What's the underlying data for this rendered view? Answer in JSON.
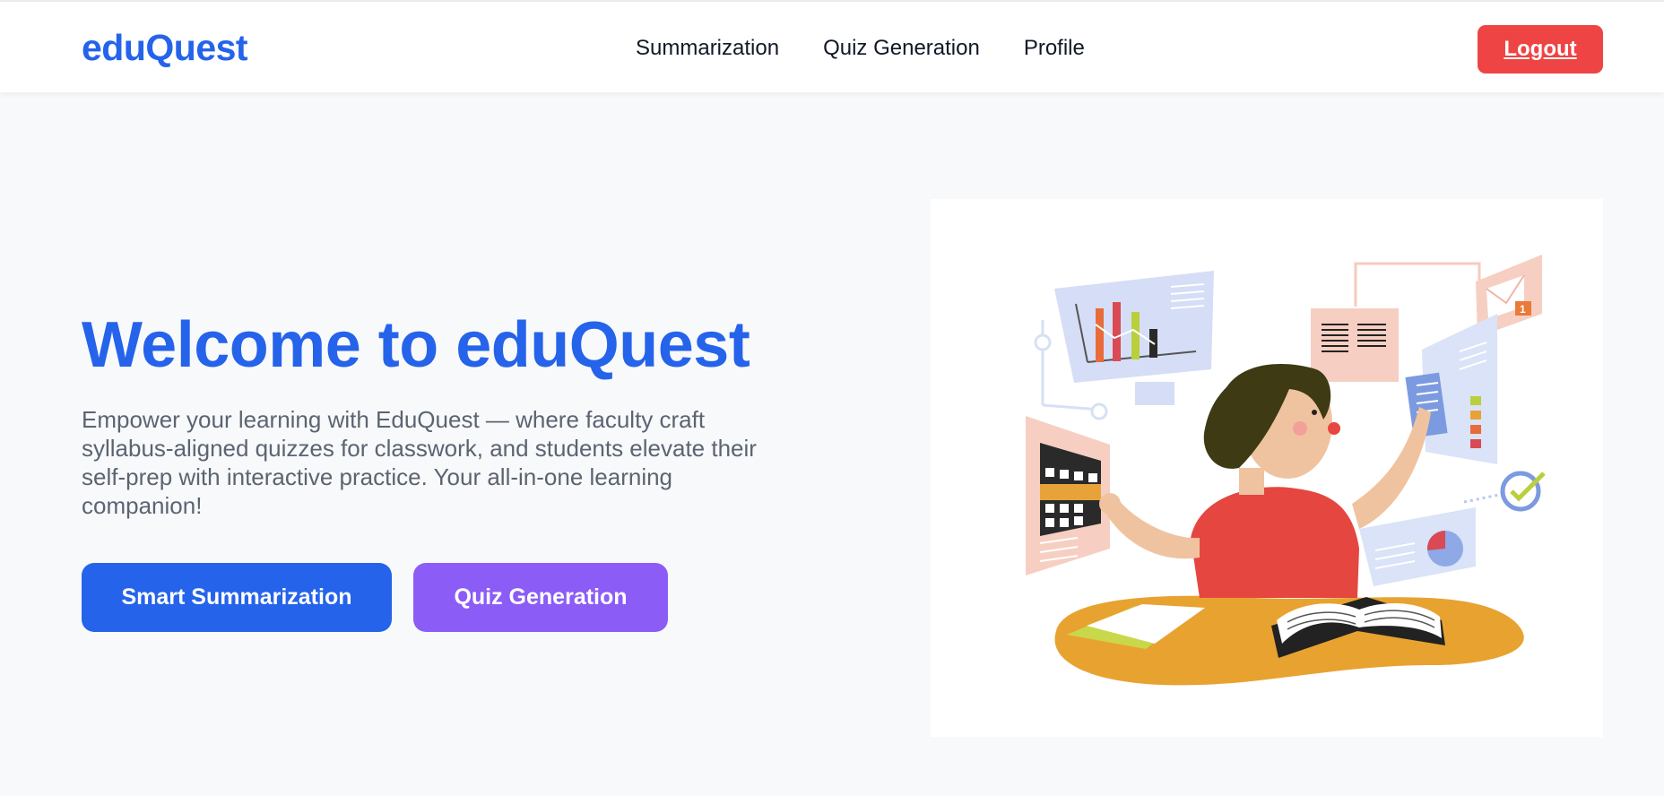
{
  "navbar": {
    "brand": "eduQuest",
    "links": [
      "Summarization",
      "Quiz Generation",
      "Profile"
    ],
    "logout_label": "Logout"
  },
  "hero": {
    "title": "Welcome to eduQuest",
    "description": "Empower your learning with EduQuest — where faculty craft syllabus-aligned quizzes for classwork, and students elevate their self-prep with interactive practice. Your all-in-one learning companion!",
    "primary_button": "Smart Summarization",
    "secondary_button": "Quiz Generation"
  },
  "illustration": {
    "badge_number": "1"
  },
  "colors": {
    "brand_blue": "#2563eb",
    "logout_red": "#ef4444",
    "quiz_purple": "#8b5cf6",
    "background": "#f8f9fb"
  }
}
